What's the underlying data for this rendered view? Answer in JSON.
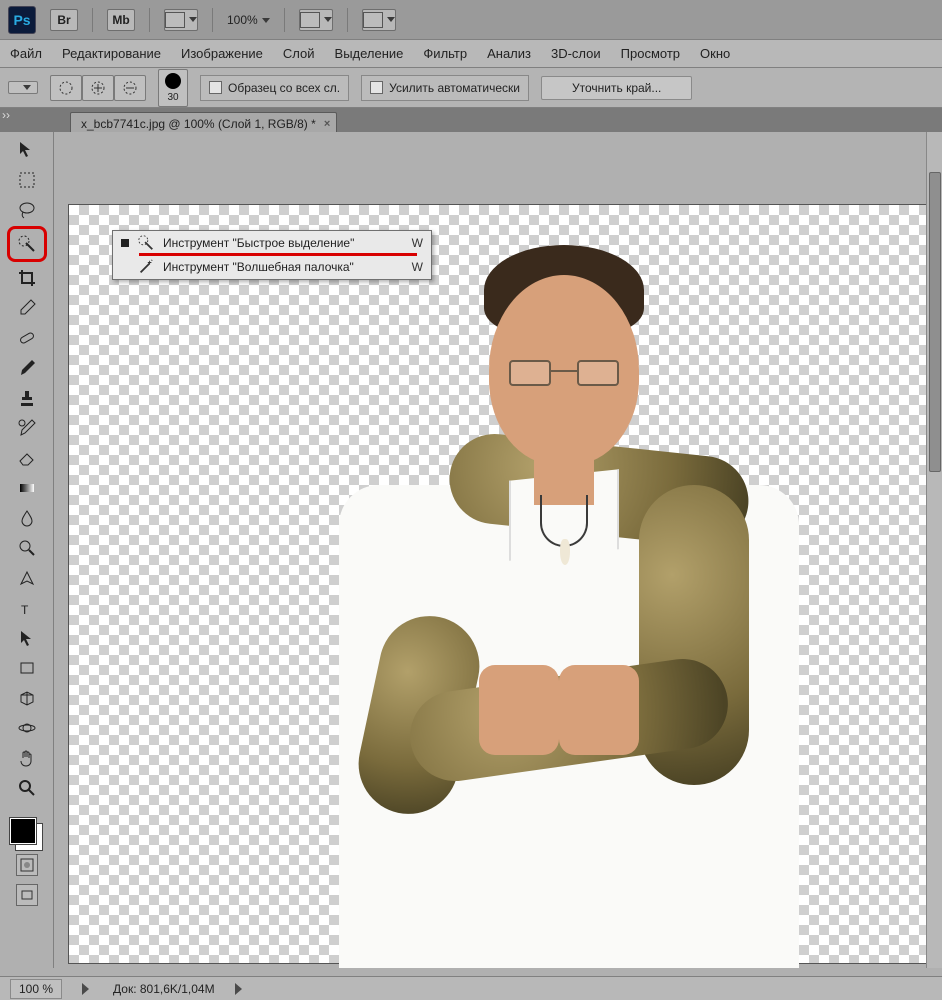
{
  "appbar": {
    "logo_text": "Ps",
    "launchers": [
      "Br",
      "Mb"
    ],
    "zoom_value": "100%"
  },
  "menubar": {
    "items": [
      "Файл",
      "Редактирование",
      "Изображение",
      "Слой",
      "Выделение",
      "Фильтр",
      "Анализ",
      "3D-слои",
      "Просмотр",
      "Окно"
    ]
  },
  "options_bar": {
    "brush_size": "30",
    "sample_all_label": "Образец со всех сл.",
    "auto_enhance_label": "Усилить автоматически",
    "refine_edge_label": "Уточнить край..."
  },
  "document_tab": {
    "title": "x_bcb7741c.jpg @ 100% (Слой 1, RGB/8) *"
  },
  "tool_flyout": {
    "items": [
      {
        "label": "Инструмент \"Быстрое выделение\"",
        "shortcut": "W",
        "selected": true,
        "icon": "quick-selection-icon"
      },
      {
        "label": "Инструмент \"Волшебная палочка\"",
        "shortcut": "W",
        "selected": false,
        "icon": "magic-wand-icon"
      }
    ]
  },
  "status": {
    "zoom": "100 %",
    "doc_info": "Док: 801,6K/1,04M"
  },
  "toolbox": {
    "tools": [
      "move-tool",
      "rectangular-marquee-tool",
      "lasso-tool",
      "quick-selection-tool",
      "crop-tool",
      "eyedropper-tool",
      "healing-brush-tool",
      "brush-tool",
      "clone-stamp-tool",
      "history-brush-tool",
      "eraser-tool",
      "gradient-tool",
      "blur-tool",
      "dodge-tool",
      "pen-tool",
      "type-tool",
      "path-selection-tool",
      "shape-tool",
      "3d-tool",
      "3d-camera-tool",
      "hand-tool",
      "zoom-tool"
    ]
  }
}
